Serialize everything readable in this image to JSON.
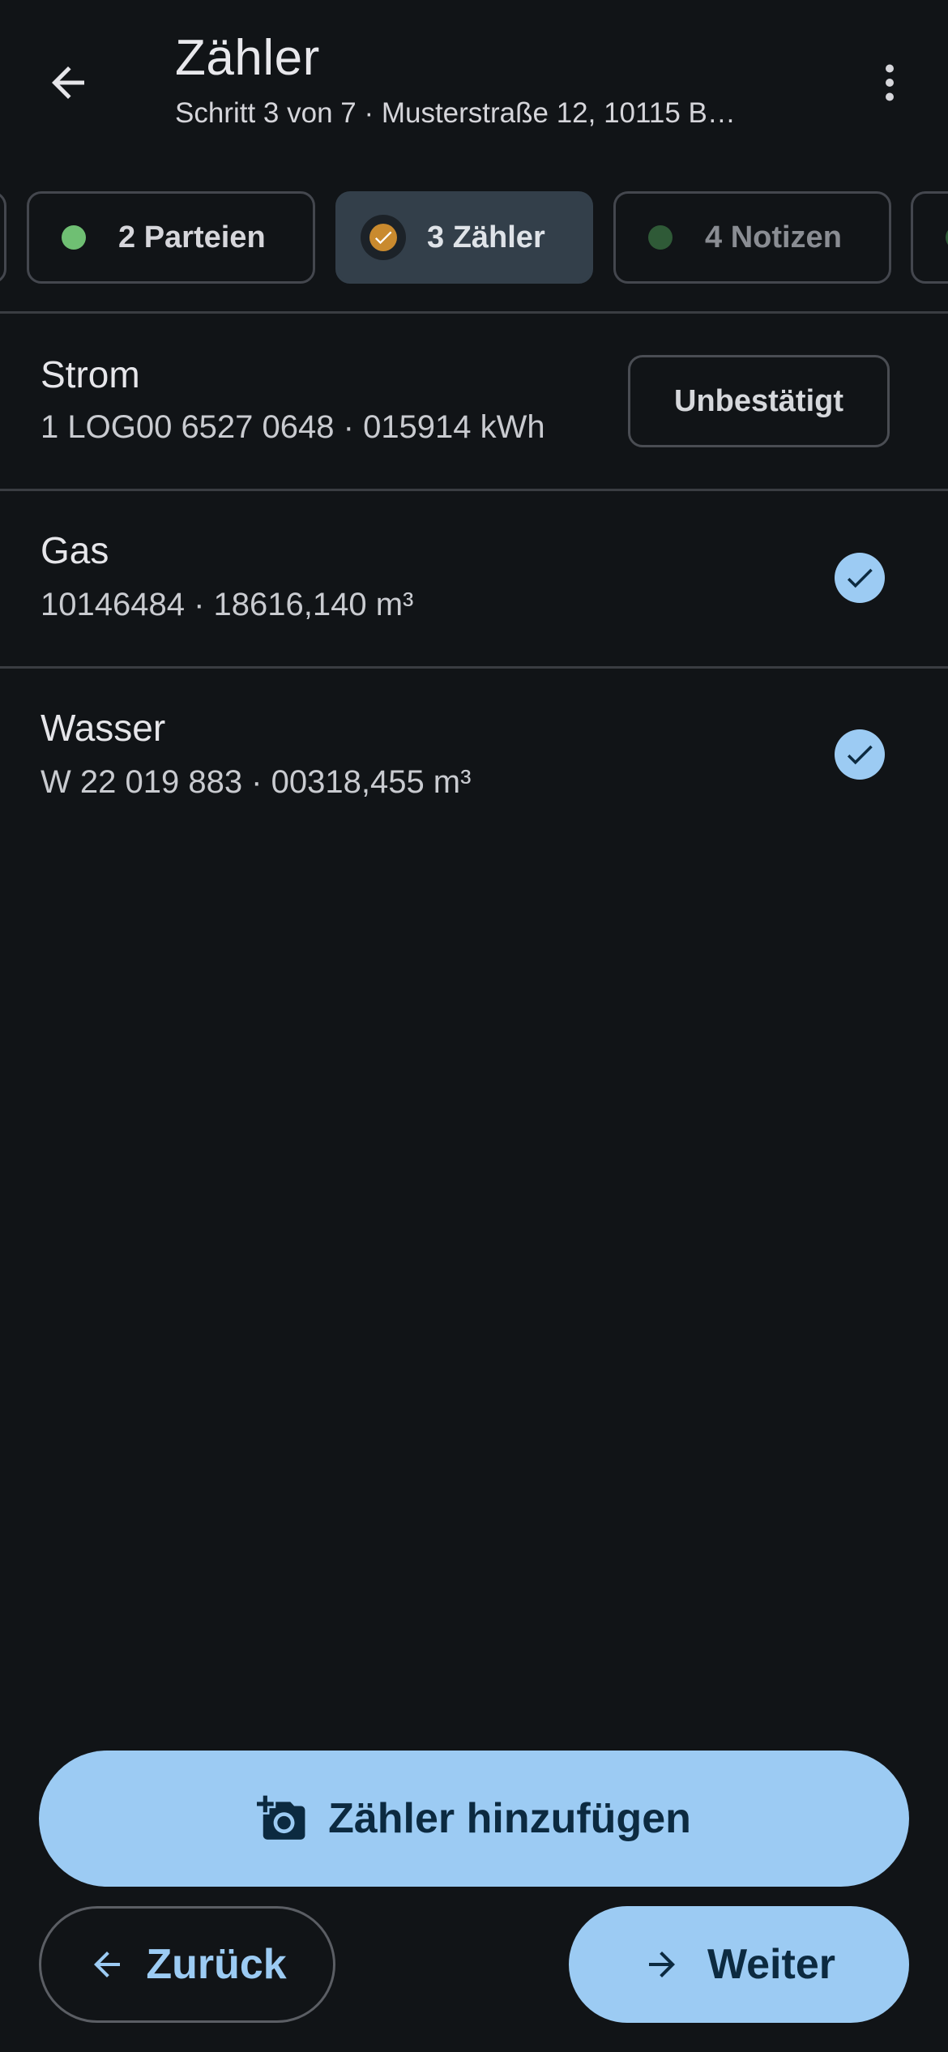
{
  "appbar": {
    "title": "Zähler",
    "subtitle": "Schritt 3 von 7 · Musterstraße 12, 10115 B…",
    "back_icon": "arrow-left-icon",
    "more_icon": "more-vert-icon"
  },
  "steps": [
    {
      "label": "2 Parteien",
      "status": "complete",
      "dot_color": "#6fbf73"
    },
    {
      "label": "3 Zähler",
      "status": "current",
      "badge_color": "#c98a2e"
    },
    {
      "label": "4 Notizen",
      "status": "upcoming",
      "dot_color": "#2f5a37"
    }
  ],
  "meters": [
    {
      "name": "Strom",
      "detail": "1 LOG00 6527 0648 · 015914 kWh",
      "confirmed": false,
      "action_label": "Unbestätigt"
    },
    {
      "name": "Gas",
      "detail": "10146484 · 18616,140 m³",
      "confirmed": true
    },
    {
      "name": "Wasser",
      "detail": "W 22 019 883 · 00318,455 m³",
      "confirmed": true
    }
  ],
  "actions": {
    "add_label": "Zähler hinzufügen",
    "add_icon": "add-camera-icon",
    "back_label": "Zurück",
    "back_icon": "arrow-left-icon",
    "next_label": "Weiter",
    "next_icon": "arrow-right-icon"
  },
  "colors": {
    "background": "#111417",
    "accent": "#9ccbf3",
    "check": "#9ccbf3",
    "on_accent": "#0c2a40"
  }
}
